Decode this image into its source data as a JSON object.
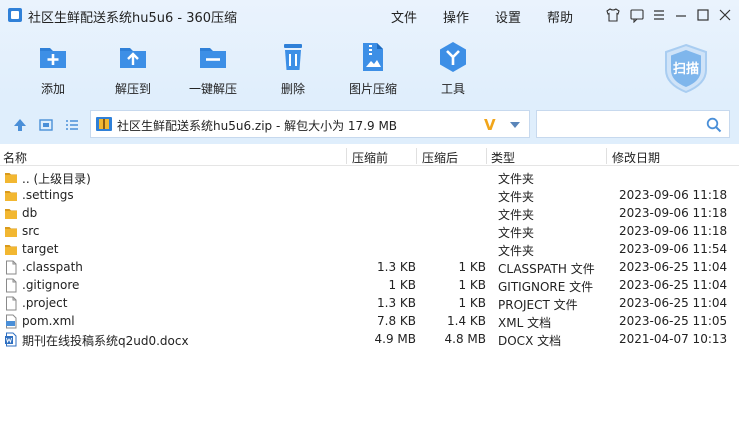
{
  "window": {
    "title": "社区生鲜配送系统hu5u6 - 360压缩",
    "menu": [
      "文件",
      "操作",
      "设置",
      "帮助"
    ]
  },
  "toolbar": [
    {
      "label": "添加",
      "icon": "add-icon"
    },
    {
      "label": "解压到",
      "icon": "extract-to-icon"
    },
    {
      "label": "一键解压",
      "icon": "one-click-extract-icon"
    },
    {
      "label": "删除",
      "icon": "delete-icon"
    },
    {
      "label": "图片压缩",
      "icon": "image-compress-icon"
    },
    {
      "label": "工具",
      "icon": "tools-icon"
    }
  ],
  "scan_label": "扫描",
  "address": {
    "text": "社区生鲜配送系统hu5u6.zip - 解包大小为 17.9 MB",
    "badge": "V"
  },
  "search": {
    "placeholder": ""
  },
  "columns": {
    "name": "名称",
    "size": "压缩前",
    "packed": "压缩后",
    "type": "类型",
    "date": "修改日期"
  },
  "files": [
    {
      "name": ".. (上级目录)",
      "size": "",
      "packed": "",
      "type": "文件夹",
      "date": "",
      "kind": "folder"
    },
    {
      "name": ".settings",
      "size": "",
      "packed": "",
      "type": "文件夹",
      "date": "2023-09-06 11:18",
      "kind": "folder"
    },
    {
      "name": "db",
      "size": "",
      "packed": "",
      "type": "文件夹",
      "date": "2023-09-06 11:18",
      "kind": "folder"
    },
    {
      "name": "src",
      "size": "",
      "packed": "",
      "type": "文件夹",
      "date": "2023-09-06 11:18",
      "kind": "folder"
    },
    {
      "name": "target",
      "size": "",
      "packed": "",
      "type": "文件夹",
      "date": "2023-09-06 11:54",
      "kind": "folder"
    },
    {
      "name": ".classpath",
      "size": "1.3 KB",
      "packed": "1 KB",
      "type": "CLASSPATH 文件",
      "date": "2023-06-25 11:04",
      "kind": "file"
    },
    {
      "name": ".gitignore",
      "size": "1 KB",
      "packed": "1 KB",
      "type": "GITIGNORE 文件",
      "date": "2023-06-25 11:04",
      "kind": "file"
    },
    {
      "name": ".project",
      "size": "1.3 KB",
      "packed": "1 KB",
      "type": "PROJECT 文件",
      "date": "2023-06-25 11:04",
      "kind": "file"
    },
    {
      "name": "pom.xml",
      "size": "7.8 KB",
      "packed": "1.4 KB",
      "type": "XML 文档",
      "date": "2023-06-25 11:05",
      "kind": "xml"
    },
    {
      "name": "期刊在线投稿系统q2ud0.docx",
      "size": "4.9 MB",
      "packed": "4.8 MB",
      "type": "DOCX 文档",
      "date": "2021-04-07 10:13",
      "kind": "docx"
    }
  ],
  "colors": {
    "accent": "#2f80d8",
    "folder": "#f2b731",
    "badge": "#f1a51a"
  }
}
